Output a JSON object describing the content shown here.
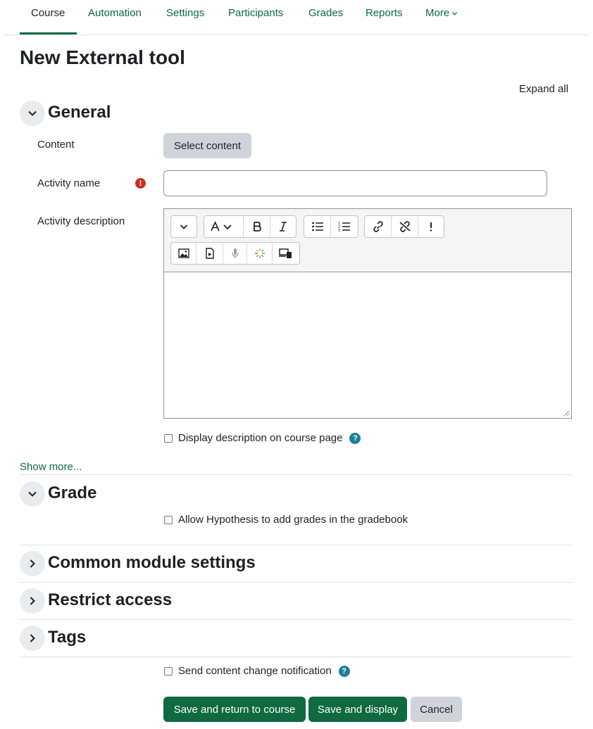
{
  "nav": {
    "items": [
      {
        "label": "Course",
        "active": true
      },
      {
        "label": "Automation"
      },
      {
        "label": "Settings"
      },
      {
        "label": "Participants"
      },
      {
        "label": "Grades"
      },
      {
        "label": "Reports"
      },
      {
        "label": "More"
      }
    ]
  },
  "page": {
    "title": "New External tool",
    "expand_all": "Expand all"
  },
  "general": {
    "title": "General",
    "content_label": "Content",
    "select_content": "Select content",
    "activity_name_label": "Activity name",
    "activity_name_value": "",
    "activity_description_label": "Activity description",
    "display_description": "Display description on course page",
    "show_more": "Show more..."
  },
  "grade": {
    "title": "Grade",
    "allow_grades": "Allow Hypothesis to add grades in the gradebook"
  },
  "sections": {
    "common": "Common module settings",
    "restrict": "Restrict access",
    "tags": "Tags"
  },
  "notify": {
    "label": "Send content change notification"
  },
  "buttons": {
    "save_return": "Save and return to course",
    "save_display": "Save and display",
    "cancel": "Cancel"
  },
  "colors": {
    "accent": "#0f6a3f",
    "required": "#ca3120",
    "help": "#1f7e9a"
  },
  "icons": {
    "required": "exclamation-circle-icon",
    "help": "question-circle-icon"
  }
}
